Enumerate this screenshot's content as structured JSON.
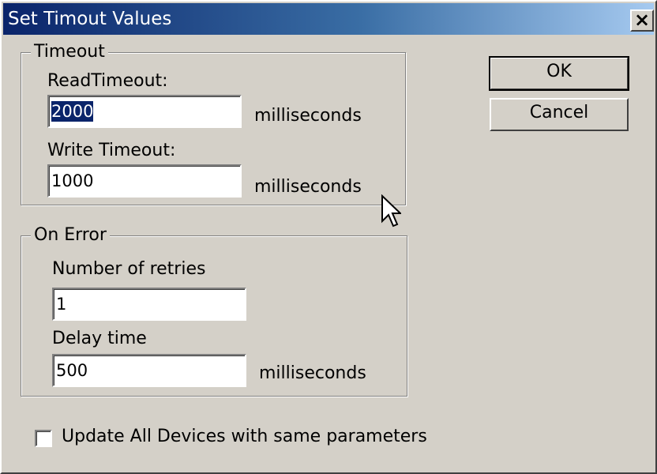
{
  "window": {
    "title": "Set Timout Values",
    "close_label": "×"
  },
  "timeout": {
    "group_label": "Timeout",
    "read_label": "ReadTimeout:",
    "read_value": "2000",
    "write_label": "Write Timeout:",
    "write_value": "1000",
    "unit": "milliseconds"
  },
  "on_error": {
    "group_label": "On Error",
    "retries_label": "Number of retries",
    "retries_value": "1",
    "delay_label": "Delay time",
    "delay_value": "500",
    "unit": "milliseconds"
  },
  "buttons": {
    "ok": "OK",
    "cancel": "Cancel"
  },
  "options": {
    "update_all_label": "Update All Devices with same parameters",
    "update_all_checked": false
  },
  "colors": {
    "face": "#d4d0c8",
    "title_start": "#0a246a",
    "title_end": "#a6caf0",
    "selection": "#0a246a"
  }
}
